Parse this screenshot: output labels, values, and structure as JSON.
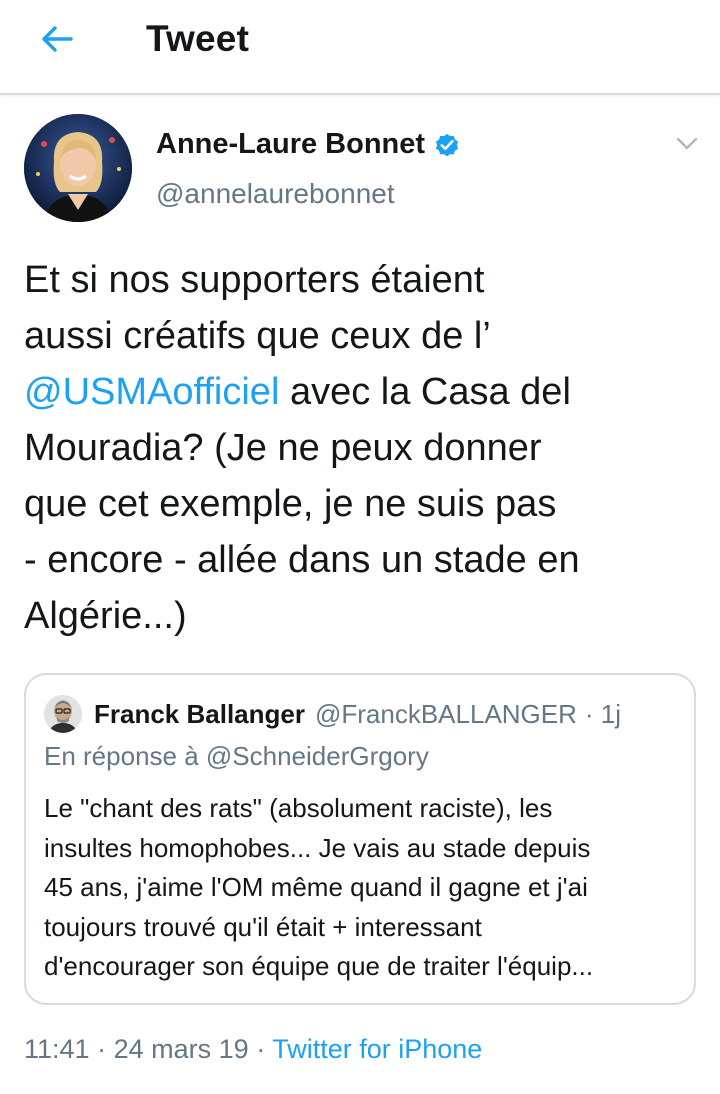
{
  "header": {
    "title": "Tweet",
    "back_icon": "back-arrow-icon",
    "accent": "#1da1f2"
  },
  "tweet": {
    "author_name": "Anne-Laure Bonnet",
    "author_handle": "@annelaurebonnet",
    "verified_icon": "verified-badge-icon",
    "menu_icon": "chevron-down-icon",
    "text_lines": [
      "Et si nos supporters étaient",
      "aussi créatifs que ceux de l’"
    ],
    "mention": "@USMAofficiel",
    "text_after_mention": " avec la Casa del",
    "text_rest": [
      "Mouradia? (Je ne peux donner",
      "que cet exemple, je ne suis pas",
      "- encore - allée dans un stade en",
      "Algérie...)"
    ],
    "time": "11:41",
    "separator": "·",
    "date": "24 mars 19",
    "source": "Twitter for iPhone"
  },
  "quoted_tweet": {
    "author_name": "Franck Ballanger",
    "author_handle": "@FranckBALLANGER",
    "time_ago": "· 1j",
    "reply_prefix": "En réponse à",
    "reply_to": "@SchneiderGrgory",
    "text_lines": [
      "Le \"chant des rats\" (absolument raciste), les",
      "insultes homophobes... Je vais au stade depuis",
      "45 ans, j'aime l'OM même quand il gagne et j'ai",
      "toujours trouvé qu'il était + interessant",
      "d'encourager son équipe que de traiter l'équip..."
    ]
  },
  "colors": {
    "text": "#14171a",
    "secondary": "#657786",
    "link": "#1da1f2",
    "border": "#d6dbe0"
  }
}
